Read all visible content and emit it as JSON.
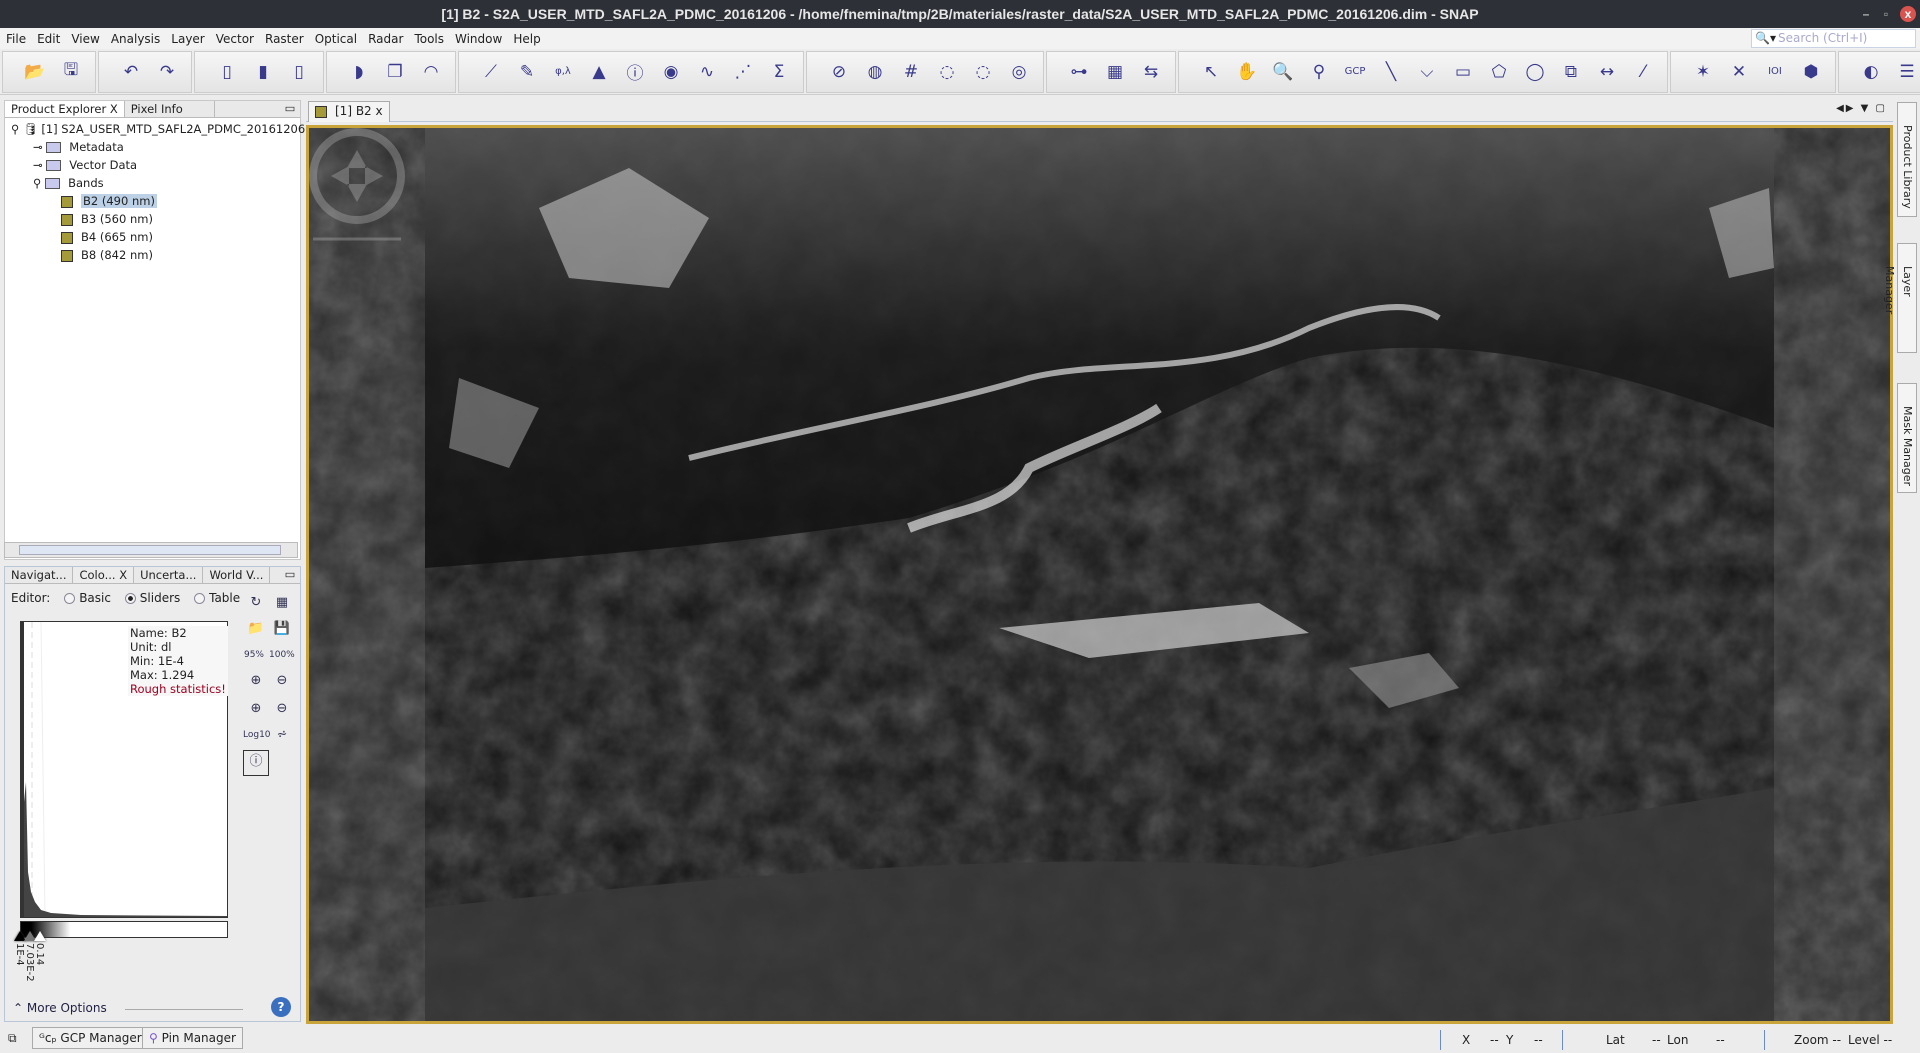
{
  "window": {
    "title": "[1] B2 - S2A_USER_MTD_SAFL2A_PDMC_20161206 - /home/fnemina/tmp/2B/materiales/raster_data/S2A_USER_MTD_SAFL2A_PDMC_20161206.dim - SNAP",
    "minimize": "–",
    "restore": "▫",
    "close": "x"
  },
  "menu": [
    "File",
    "Edit",
    "View",
    "Analysis",
    "Layer",
    "Vector",
    "Raster",
    "Optical",
    "Radar",
    "Tools",
    "Window",
    "Help"
  ],
  "search": {
    "placeholder": "Search (Ctrl+I)",
    "icon": "search-icon"
  },
  "toolbar": {
    "groups": [
      [
        {
          "n": "open-product-icon",
          "g": "📂"
        },
        {
          "n": "save-product-icon",
          "g": "🖫"
        }
      ],
      [
        {
          "n": "undo-icon",
          "g": "↶"
        },
        {
          "n": "redo-icon",
          "g": "↷"
        }
      ],
      [
        {
          "n": "import-raster-icon",
          "g": "▯"
        },
        {
          "n": "import-vector-icon",
          "g": "▮"
        },
        {
          "n": "export-icon",
          "g": "▯"
        }
      ],
      [
        {
          "n": "rgb-image-icon",
          "g": "◗"
        },
        {
          "n": "band-maths-icon",
          "g": "❐"
        },
        {
          "n": "world-view-icon",
          "g": "◠"
        }
      ],
      [
        {
          "n": "scatter-plot-icon",
          "g": "⟋"
        },
        {
          "n": "profile-plot-icon",
          "g": "✎"
        },
        {
          "n": "geo-coding-icon",
          "g": "φ,λ"
        },
        {
          "n": "histogram-icon",
          "g": "▲"
        },
        {
          "n": "information-icon",
          "g": "ⓘ"
        },
        {
          "n": "statistics-icon",
          "g": "◉"
        },
        {
          "n": "spectrum-icon",
          "g": "∿"
        },
        {
          "n": "correlative-plot-icon",
          "g": "⋰"
        },
        {
          "n": "sum-icon",
          "g": "Σ"
        }
      ],
      [
        {
          "n": "pin-overlay-icon",
          "g": "⊘"
        },
        {
          "n": "gcp-overlay-icon",
          "g": "◍"
        },
        {
          "n": "graticule-overlay-icon",
          "g": "#"
        },
        {
          "n": "pin-disabled-icon",
          "g": "◌"
        },
        {
          "n": "gcp-disabled-icon",
          "g": "◌"
        },
        {
          "n": "world-map-overlay-icon",
          "g": "◎"
        }
      ],
      [
        {
          "n": "graph-builder-icon",
          "g": "⊶"
        },
        {
          "n": "batch-processing-icon",
          "g": "▦"
        },
        {
          "n": "sync-views-icon",
          "g": "⇆"
        }
      ],
      [
        {
          "n": "select-tool-icon",
          "g": "↖"
        },
        {
          "n": "pan-tool-icon",
          "g": "✋"
        },
        {
          "n": "zoom-tool-icon",
          "g": "🔍"
        },
        {
          "n": "pin-placing-icon",
          "g": "⚲"
        },
        {
          "n": "gcp-placing-icon",
          "g": "GCP"
        },
        {
          "n": "line-drawing-icon",
          "g": "╲"
        },
        {
          "n": "polyline-drawing-icon",
          "g": "⌵"
        },
        {
          "n": "rectangle-drawing-icon",
          "g": "▭"
        },
        {
          "n": "polygon-drawing-icon",
          "g": "⬠"
        },
        {
          "n": "ellipse-drawing-icon",
          "g": "◯"
        },
        {
          "n": "insert-figure-icon",
          "g": "⧉"
        },
        {
          "n": "range-finder-icon",
          "g": "↔"
        },
        {
          "n": "magic-wand-icon",
          "g": "⁄"
        }
      ],
      [
        {
          "n": "star-icon",
          "g": "✶"
        },
        {
          "n": "xy-axis-icon",
          "g": "✕"
        },
        {
          "n": "binary-icon",
          "g": "IOI"
        },
        {
          "n": "cluster-icon",
          "g": "⬢"
        }
      ],
      [
        {
          "n": "layer-icon",
          "g": "◐"
        },
        {
          "n": "layer-stack-icon",
          "g": "☰"
        },
        {
          "n": "more-icon",
          "g": "»"
        }
      ]
    ]
  },
  "productExplorer": {
    "tabs": [
      "Product Explorer",
      "Pixel Info"
    ],
    "tabClose": "X",
    "product": "[1] S2A_USER_MTD_SAFL2A_PDMC_20161206",
    "nodes": [
      "Metadata",
      "Vector Data",
      "Bands"
    ],
    "bands": [
      "B2 (490 nm)",
      "B3 (560 nm)",
      "B4 (665 nm)",
      "B8 (842 nm)"
    ],
    "selectedBand": "B2 (490 nm)"
  },
  "colour": {
    "tabs": [
      "Navigat...",
      "Colo...",
      "Uncerta...",
      "World V..."
    ],
    "tabClose": "X",
    "editorLabel": "Editor:",
    "modes": [
      "Basic",
      "Sliders",
      "Table"
    ],
    "selectedMode": "Sliders",
    "stats": {
      "name": "Name: B2",
      "unit": "Unit: dl",
      "min": "Min: 1E-4",
      "max": "Max: 1.294",
      "warning": "Rough statistics!"
    },
    "sliders": [
      "1E-4",
      "7.03E-2",
      "0.14"
    ],
    "buttons": {
      "pct95": "95%",
      "pct100": "100%",
      "log": "Log10"
    },
    "moreOptions": "More Options",
    "warningColor": "#a00020"
  },
  "view": {
    "tab": "[1] B2",
    "tabClose": "x"
  },
  "rightTabs": [
    "Product Library",
    "Layer Manager",
    "Mask Manager"
  ],
  "bottomButtons": [
    "GCP Manager",
    "Pin Manager"
  ],
  "status": {
    "x": "X",
    "xv": "--",
    "y": "Y",
    "yv": "--",
    "lat": "Lat",
    "latv": "--",
    "lon": "Lon",
    "lonv": "--",
    "zoom": "Zoom --",
    "level": "Level --"
  },
  "colors": {
    "highlight": "#c9a43a",
    "titlebar": "#2d3036",
    "selection": "#bcd0e6"
  }
}
